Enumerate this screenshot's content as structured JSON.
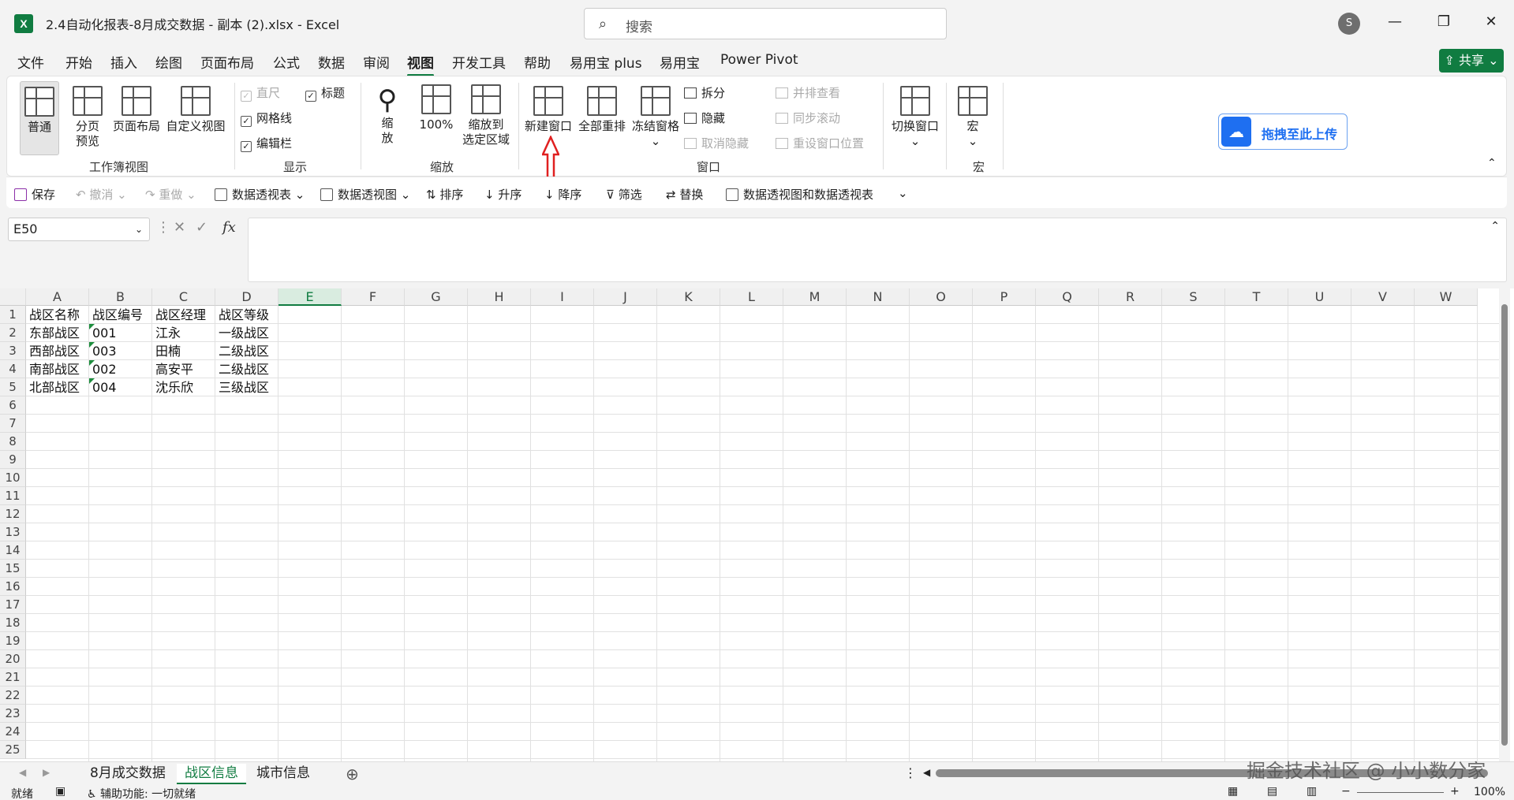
{
  "window": {
    "doc_title": "2.4自动化报表-8月成交数据 - 副本 (2).xlsx  -  Excel",
    "search_placeholder": "搜索",
    "account_initial": "S",
    "logo_text": "X"
  },
  "menu": [
    "文件",
    "开始",
    "插入",
    "绘图",
    "页面布局",
    "公式",
    "数据",
    "审阅",
    "视图",
    "开发工具",
    "帮助",
    "易用宝 plus",
    "易用宝",
    "Power Pivot"
  ],
  "menu_active": "视图",
  "share_label": "共享",
  "ribbon": {
    "workbook_views": {
      "group": "工作簿视图",
      "normal": "普通",
      "page_break_1": "分页",
      "page_break_2": "预览",
      "page_layout": "页面布局",
      "custom_view": "自定义视图"
    },
    "show": {
      "group": "显示",
      "ruler": "直尺",
      "gridlines": "网格线",
      "formula_bar": "编辑栏",
      "headings": "标题"
    },
    "zoom": {
      "group": "缩放",
      "zoom_1": "缩",
      "zoom_2": "放",
      "zoom_100": "100%",
      "zoom_sel_1": "缩放到",
      "zoom_sel_2": "选定区域"
    },
    "window": {
      "group": "窗口",
      "new_window": "新建窗口",
      "arrange_all": "全部重排",
      "freeze": "冻结窗格",
      "split": "拆分",
      "hide": "隐藏",
      "unhide": "取消隐藏",
      "side_by_side": "并排查看",
      "sync_scroll": "同步滚动",
      "reset_pos": "重设窗口位置",
      "switch": "切换窗口"
    },
    "macros": {
      "group": "宏",
      "macros": "宏"
    },
    "upload": "拖拽至此上传"
  },
  "qat": {
    "save": "保存",
    "undo": "撤消",
    "redo": "重做",
    "pivot_table": "数据透视表",
    "pivot_chart": "数据透视图",
    "sort": "排序",
    "asc": "升序",
    "desc": "降序",
    "filter": "筛选",
    "replace": "替换",
    "pivot_both": "数据透视图和数据透视表"
  },
  "name_box": "E50",
  "fx_label": "fx",
  "columns": [
    "A",
    "B",
    "C",
    "D",
    "E",
    "F",
    "G",
    "H",
    "I",
    "J",
    "K",
    "L",
    "M",
    "N",
    "O",
    "P",
    "Q",
    "R",
    "S",
    "T",
    "U",
    "V",
    "W"
  ],
  "rows": [
    "1",
    "2",
    "3",
    "4",
    "5",
    "6",
    "7",
    "8",
    "9",
    "10",
    "11",
    "12",
    "13",
    "14",
    "15",
    "16",
    "17",
    "18",
    "19",
    "20",
    "21",
    "22",
    "23",
    "24",
    "25"
  ],
  "cells": [
    [
      "战区名称",
      "战区编号",
      "战区经理",
      "战区等级"
    ],
    [
      "东部战区",
      "001",
      "江永",
      "一级战区"
    ],
    [
      "西部战区",
      "003",
      "田楠",
      "二级战区"
    ],
    [
      "南部战区",
      "002",
      "高安平",
      "二级战区"
    ],
    [
      "北部战区",
      "004",
      "沈乐欣",
      "三级战区"
    ]
  ],
  "sheets": [
    "8月成交数据",
    "战区信息",
    "城市信息"
  ],
  "active_sheet": "战区信息",
  "status": {
    "ready": "就绪",
    "accessibility": "辅助功能: 一切就绪",
    "zoom": "100%"
  },
  "watermark": "掘金技术社区 @ 小小数分家",
  "colors": {
    "accent": "#107c41",
    "arrow": "#e02020",
    "upload_blue": "#1e6ff1"
  }
}
